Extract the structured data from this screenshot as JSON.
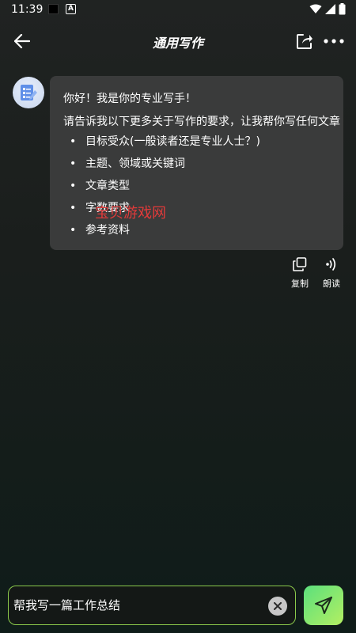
{
  "status_bar": {
    "time": "11:39",
    "badge": "A"
  },
  "header": {
    "title": "通用写作"
  },
  "message": {
    "greeting": "你好！我是你的专业写手！",
    "intro": "请告诉我以下更多关于写作的要求，让我帮你写任何文章",
    "bullet": "•",
    "items": [
      "目标受众(一般读者还是专业人士？)",
      "主题、领域或关键词",
      "文章类型",
      "字数要求",
      "参考资料"
    ]
  },
  "watermark": "宝贝游戏网",
  "actions": {
    "copy_label": "复制",
    "read_label": "朗读"
  },
  "input": {
    "value": "帮我写一篇工作总结"
  },
  "colors": {
    "accent": "#8ac94b",
    "send_gradient_start": "#5be07d",
    "send_gradient_end": "#b3ef62",
    "bubble": "#3a3b3b"
  }
}
